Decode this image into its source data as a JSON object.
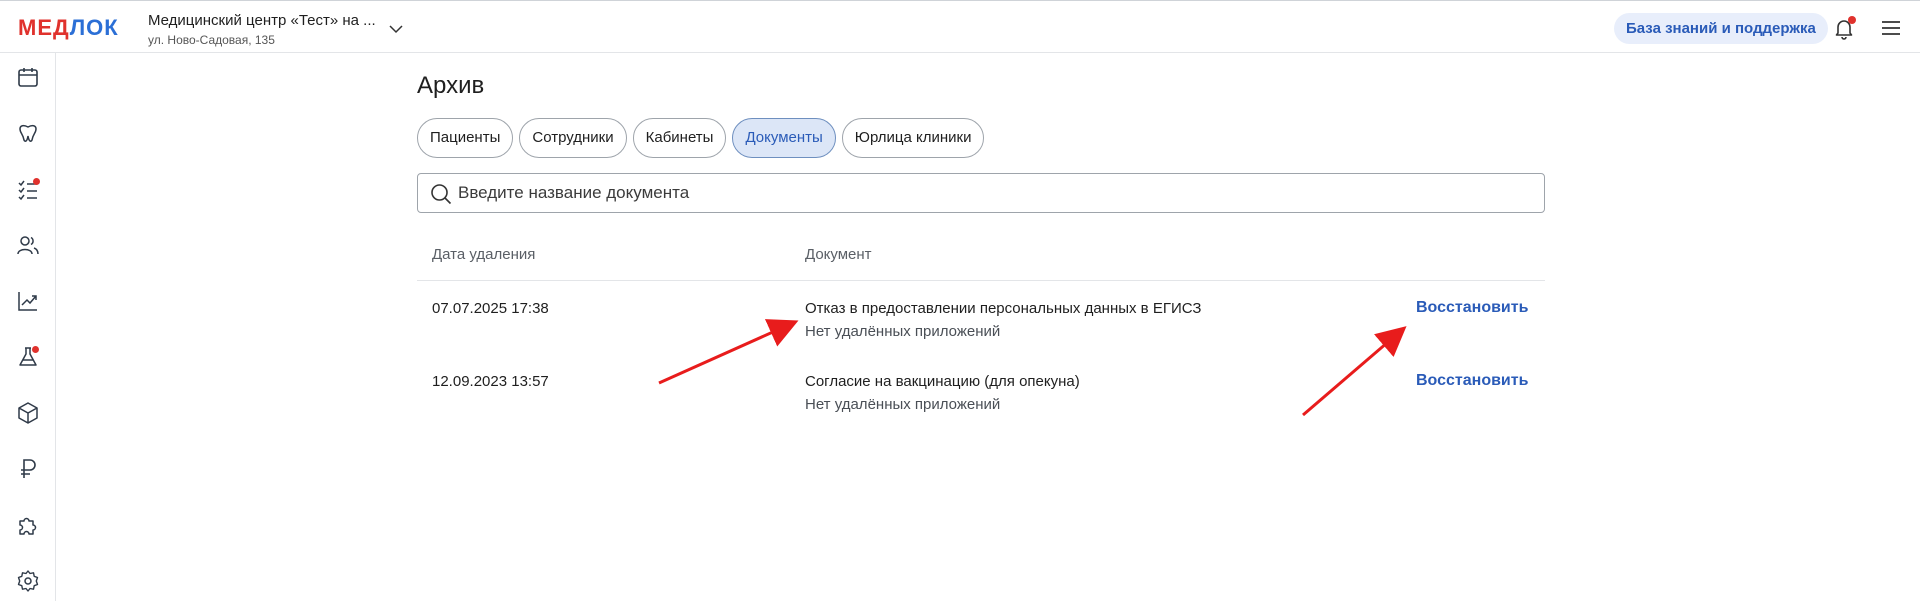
{
  "header": {
    "logo": {
      "part1": "МЕД",
      "part2": "ЛОК"
    },
    "clinic_name": "Медицинский центр «Тест» на ...",
    "clinic_address": "ул. Ново-Садовая, 135",
    "support_label": "База знаний и поддержка"
  },
  "sidebar": {
    "items": [
      {
        "icon": "calendar-icon"
      },
      {
        "icon": "tooth-icon"
      },
      {
        "icon": "task-list-icon",
        "badge": true
      },
      {
        "icon": "users-icon"
      },
      {
        "icon": "chart-icon"
      },
      {
        "icon": "flask-icon",
        "badge": true
      },
      {
        "icon": "box-icon"
      },
      {
        "icon": "ruble-icon"
      },
      {
        "icon": "puzzle-icon"
      },
      {
        "icon": "gear-icon"
      }
    ]
  },
  "page": {
    "title": "Архив",
    "tabs": [
      {
        "label": "Пациенты",
        "active": false
      },
      {
        "label": "Сотрудники",
        "active": false
      },
      {
        "label": "Кабинеты",
        "active": false
      },
      {
        "label": "Документы",
        "active": true
      },
      {
        "label": "Юрлица клиники",
        "active": false
      }
    ],
    "search": {
      "placeholder": "Введите название документа"
    },
    "table": {
      "columns": [
        "Дата удаления",
        "Документ"
      ],
      "rows": [
        {
          "date": "07.07.2025 17:38",
          "document": "Отказ в предоставлении персональных данных в ЕГИСЗ",
          "attachments": "Нет удалённых приложений",
          "action": "Восстановить"
        },
        {
          "date": "12.09.2023 13:57",
          "document": "Согласие на вакцинацию (для опекуна)",
          "attachments": "Нет удалённых приложений",
          "action": "Восстановить"
        }
      ]
    }
  },
  "colors": {
    "accent": "#2a5bb8",
    "logo_red": "#e0322d",
    "logo_blue": "#2b6fd6",
    "annotation_arrow": "#e81c1c"
  }
}
